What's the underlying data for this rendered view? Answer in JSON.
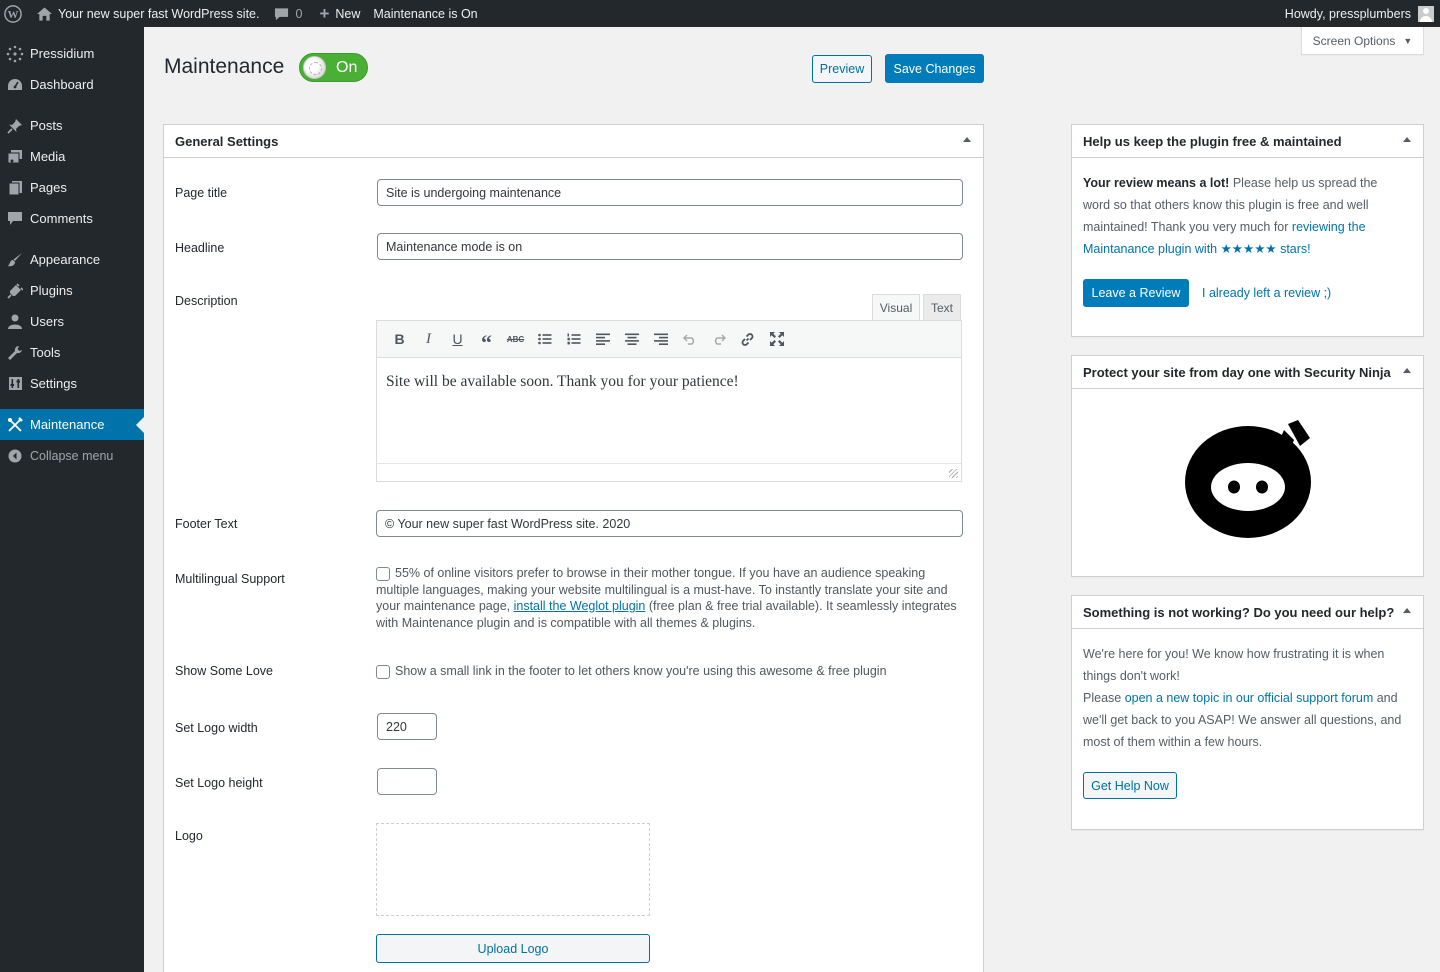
{
  "adminbar": {
    "site_name": "Your new super fast WordPress site.",
    "comments_count": "0",
    "new_label": "New",
    "maintenance_status": "Maintenance is On",
    "howdy": "Howdy, pressplumbers"
  },
  "sidebar": {
    "items": [
      {
        "label": "Pressidium",
        "icon": "pressidium-icon"
      },
      {
        "label": "Dashboard",
        "icon": "dashboard-icon"
      },
      {
        "label": "Posts",
        "icon": "pin-icon"
      },
      {
        "label": "Media",
        "icon": "media-icon"
      },
      {
        "label": "Pages",
        "icon": "pages-icon"
      },
      {
        "label": "Comments",
        "icon": "comment-icon"
      },
      {
        "label": "Appearance",
        "icon": "brush-icon"
      },
      {
        "label": "Plugins",
        "icon": "plug-icon"
      },
      {
        "label": "Users",
        "icon": "user-icon"
      },
      {
        "label": "Tools",
        "icon": "wrench-icon"
      },
      {
        "label": "Settings",
        "icon": "settings-icon"
      },
      {
        "label": "Maintenance",
        "icon": "maintenance-icon",
        "current": true
      },
      {
        "label": "Collapse menu",
        "icon": "collapse-icon"
      }
    ]
  },
  "screen_options": {
    "label": "Screen Options"
  },
  "header": {
    "title": "Maintenance",
    "toggle_label": "On",
    "preview_label": "Preview",
    "save_label": "Save Changes"
  },
  "general": {
    "heading": "General Settings",
    "page_title_label": "Page title",
    "page_title_value": "Site is undergoing maintenance",
    "headline_label": "Headline",
    "headline_value": "Maintenance mode is on",
    "description_label": "Description",
    "tab_visual": "Visual",
    "tab_text": "Text",
    "toolbar": [
      "bold",
      "italic",
      "underline",
      "blockquote",
      "strikethrough",
      "bullet-list",
      "numbered-list",
      "align-left",
      "align-center",
      "align-right",
      "undo",
      "redo",
      "link",
      "fullscreen"
    ],
    "description_value": "Site will be available soon. Thank you for your patience!",
    "footer_label": "Footer Text",
    "footer_value": "© Your new super fast WordPress site. 2020",
    "multilingual_label": "Multilingual Support",
    "multilingual_text_1": "55% of online visitors prefer to browse in their mother tongue. If you have an audience speaking multiple languages, making your website multilingual is a must-have. To instantly translate your site and your maintenance page, ",
    "multilingual_link": "install the Weglot plugin",
    "multilingual_text_2": " (free plan & free trial available). It seamlessly integrates with Maintenance plugin and is compatible with all themes & plugins.",
    "love_label": "Show Some Love",
    "love_text": "Show a small link in the footer to let others know you're using this awesome & free plugin",
    "logo_width_label": "Set Logo width",
    "logo_width_value": "220",
    "logo_height_label": "Set Logo height",
    "logo_height_value": "",
    "logo_label": "Logo",
    "upload_label": "Upload Logo"
  },
  "review_box": {
    "heading": "Help us keep the plugin free & maintained",
    "bold_intro": "Your review means a lot!",
    "text_1": " Please help us spread the word so that others know this plugin is free and well maintained! Thank you very much for ",
    "link": "reviewing the Maintanance plugin with ★★★★★ stars!",
    "leave_review": "Leave a Review",
    "already_left": "I already left a review ;)"
  },
  "ninja_box": {
    "heading": "Protect your site from day one with Security Ninja"
  },
  "help_box": {
    "heading": "Something is not working? Do you need our help?",
    "text_1": "We're here for you! We know how frustrating it is when things don't work!",
    "text_2": "Please ",
    "link": "open a new topic in our official support forum",
    "text_3": " and we'll get back to you ASAP! We answer all questions, and most of them within a few hours.",
    "button": "Get Help Now"
  },
  "colors": {
    "accent": "#0073aa",
    "primary_button": "#007cba",
    "toggle_on": "#49b035",
    "admin_bg": "#23282d"
  }
}
